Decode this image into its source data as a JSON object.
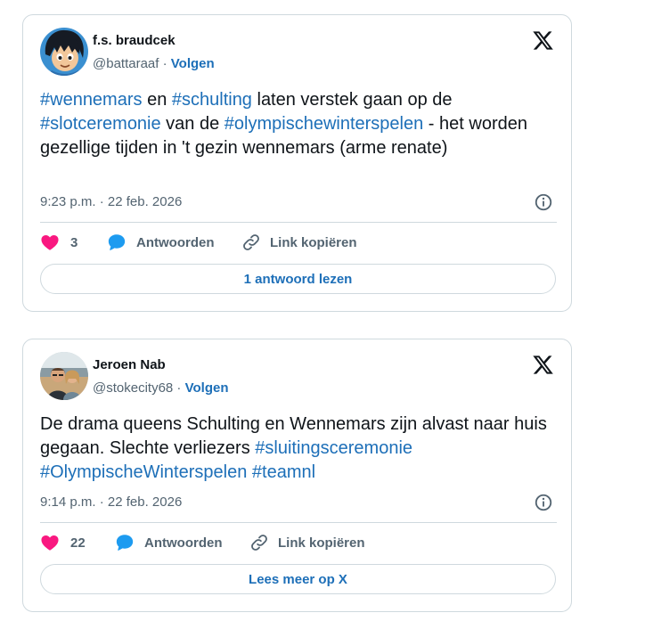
{
  "tweets": [
    {
      "avatar": "cartoon-avatar",
      "name": "f.s. braudcek",
      "handle": "@battaraaf",
      "separator": " · ",
      "follow_label": "Volgen",
      "text": {
        "h1": "#wennemars",
        "t1": " en ",
        "h2": "#schulting",
        "t2": " laten verstek gaan op de ",
        "h3": "#slotceremonie",
        "t3": " van de ",
        "h4": "#olympischewinterspelen",
        "t4": " - het worden gezellige tijden in 't gezin wennemars (arme renate)"
      },
      "time": "9:23 p.m.",
      "date_sep": " · ",
      "date": "22 feb. 2026",
      "likes": "3",
      "reply_label": "Antwoorden",
      "copy_label": "Link kopiëren",
      "button_label": "1 antwoord lezen"
    },
    {
      "avatar": "photo-avatar",
      "name": "Jeroen Nab",
      "handle": "@stokecity68",
      "separator": " · ",
      "follow_label": "Volgen",
      "text": {
        "t1": "De drama queens Schulting en Wennemars zijn alvast naar huis gegaan. Slechte verliezers  ",
        "h1": "#sluitingsceremonie",
        "h2": "#OlympischeWinterspelen",
        "h3": "#teamnl"
      },
      "time": "9:14 p.m.",
      "date_sep": " · ",
      "date": "22 feb. 2026",
      "likes": "22",
      "reply_label": "Antwoorden",
      "copy_label": "Link kopiëren",
      "button_label": "Lees meer op X"
    }
  ],
  "colors": {
    "link": "#1d6fb8",
    "heart": "#f91880",
    "reply_bubble": "#1d9bf0",
    "text": "#0f1419",
    "muted": "#536471",
    "border": "#cfd9de"
  },
  "icons": [
    "x-logo-icon",
    "info-icon",
    "heart-icon",
    "reply-bubble-icon",
    "link-icon"
  ]
}
